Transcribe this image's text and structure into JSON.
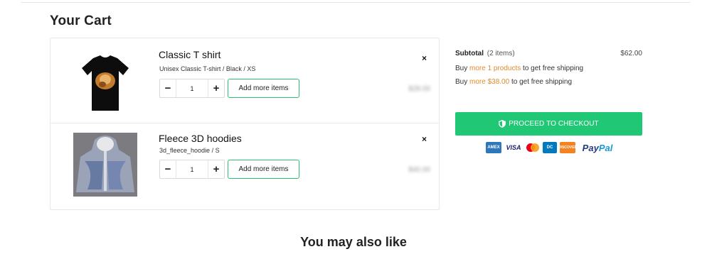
{
  "page_title": "Your Cart",
  "cart": {
    "items": [
      {
        "name": "Classic T shirt",
        "variant": "Unisex Classic T-shirt / Black / XS",
        "quantity": "1",
        "add_more_label": "Add more items",
        "remove_glyph": "×",
        "price": "$28.00",
        "thumb_icon": "black-tshirt"
      },
      {
        "name": "Fleece 3D hoodies",
        "variant": "3d_fleece_hoodie / S",
        "quantity": "1",
        "add_more_label": "Add more items",
        "remove_glyph": "×",
        "price": "$40.00",
        "thumb_icon": "fleece-hoodie"
      }
    ],
    "qty_minus": "−",
    "qty_plus": "+"
  },
  "summary": {
    "subtotal_label": "Subtotal",
    "item_count": "(2 items)",
    "subtotal_amount": "$62.00",
    "ship1_prefix": "Buy ",
    "ship1_highlight": "more 1 products",
    "ship1_suffix": " to get free shipping",
    "ship2_prefix": "Buy ",
    "ship2_highlight": "more $38.00",
    "ship2_suffix": " to get free shipping",
    "checkout_label": "PROCEED TO CHECKOUT",
    "checkout_icon": "shield-icon",
    "highlight_color": "#e08a2c",
    "checkout_color": "#20c876"
  },
  "payments": {
    "amex": "AMEX",
    "visa": "VISA",
    "diners": "DC",
    "discover": "DISCOVER",
    "paypal_a": "Pay",
    "paypal_b": "Pal"
  },
  "recommendations_title": "You may also like"
}
